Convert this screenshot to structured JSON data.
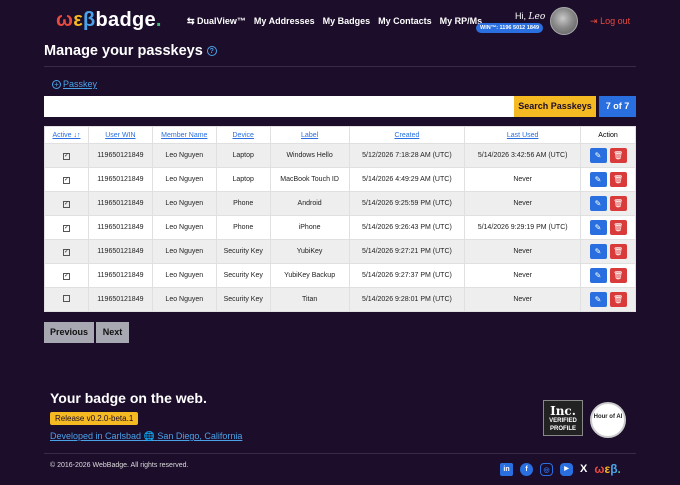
{
  "header": {
    "logo": {
      "p1": "ω",
      "p2": "ε",
      "p3": "β",
      "p4": "badge",
      "p5": "."
    },
    "nav": [
      "⇆ DualView™",
      "My Addresses",
      "My Badges",
      "My Contacts",
      "My RP/Ms"
    ],
    "greeting": "Hi,",
    "user_name": "Leo",
    "win_badge": "WIN™: 1196 5012 1849",
    "logout": "Log out"
  },
  "page": {
    "title": "Manage your passkeys",
    "add_link": "Passkey",
    "search_button": "Search Passkeys",
    "count": "7 of 7"
  },
  "table": {
    "columns": [
      "Active ↓↑",
      "User WIN",
      "Member Name",
      "Device",
      "Label",
      "Created",
      "Last Used",
      "Action"
    ],
    "rows": [
      {
        "active": true,
        "win": "119650121849",
        "name": "Leo Nguyen",
        "device": "Laptop",
        "label": "Windows Hello",
        "created": "5/12/2026 7:18:28 AM (UTC)",
        "last_used": "5/14/2026 3:42:56 AM (UTC)"
      },
      {
        "active": true,
        "win": "119650121849",
        "name": "Leo Nguyen",
        "device": "Laptop",
        "label": "MacBook Touch ID",
        "created": "5/14/2026 4:49:29 AM (UTC)",
        "last_used": "Never"
      },
      {
        "active": true,
        "win": "119650121849",
        "name": "Leo Nguyen",
        "device": "Phone",
        "label": "Android",
        "created": "5/14/2026 9:25:59 PM (UTC)",
        "last_used": "Never"
      },
      {
        "active": true,
        "win": "119650121849",
        "name": "Leo Nguyen",
        "device": "Phone",
        "label": "iPhone",
        "created": "5/14/2026 9:26:43 PM (UTC)",
        "last_used": "5/14/2026 9:29:19 PM (UTC)"
      },
      {
        "active": true,
        "win": "119650121849",
        "name": "Leo Nguyen",
        "device": "Security Key",
        "label": "YubiKey",
        "created": "5/14/2026 9:27:21 PM (UTC)",
        "last_used": "Never"
      },
      {
        "active": true,
        "win": "119650121849",
        "name": "Leo Nguyen",
        "device": "Security Key",
        "label": "YubiKey Backup",
        "created": "5/14/2026 9:27:37 PM (UTC)",
        "last_used": "Never"
      },
      {
        "active": false,
        "win": "119650121849",
        "name": "Leo Nguyen",
        "device": "Security Key",
        "label": "Titan",
        "created": "5/14/2026 9:28:01 PM (UTC)",
        "last_used": "Never"
      }
    ]
  },
  "pager": {
    "previous": "Previous",
    "next": "Next"
  },
  "footer": {
    "title": "Your badge on the web.",
    "release": "Release v0.2.0-beta.1",
    "developed": "Developed in Carlsbad",
    "location": "San Diego, California",
    "inc_top": "Inc.",
    "inc_bottom": "VERIFIED PROFILE",
    "hoa": "Hour of AI",
    "copyright": "© 2016-2026 WebBadge. All rights reserved.",
    "socials": [
      "linkedin-icon",
      "facebook-icon",
      "instagram-icon",
      "youtube-icon",
      "x-icon",
      "webbadge-icon"
    ]
  },
  "colors": {
    "background": "#1c0d2b",
    "accent": "#2a6fe0",
    "warning": "#f5b921",
    "danger": "#d93a3a"
  }
}
